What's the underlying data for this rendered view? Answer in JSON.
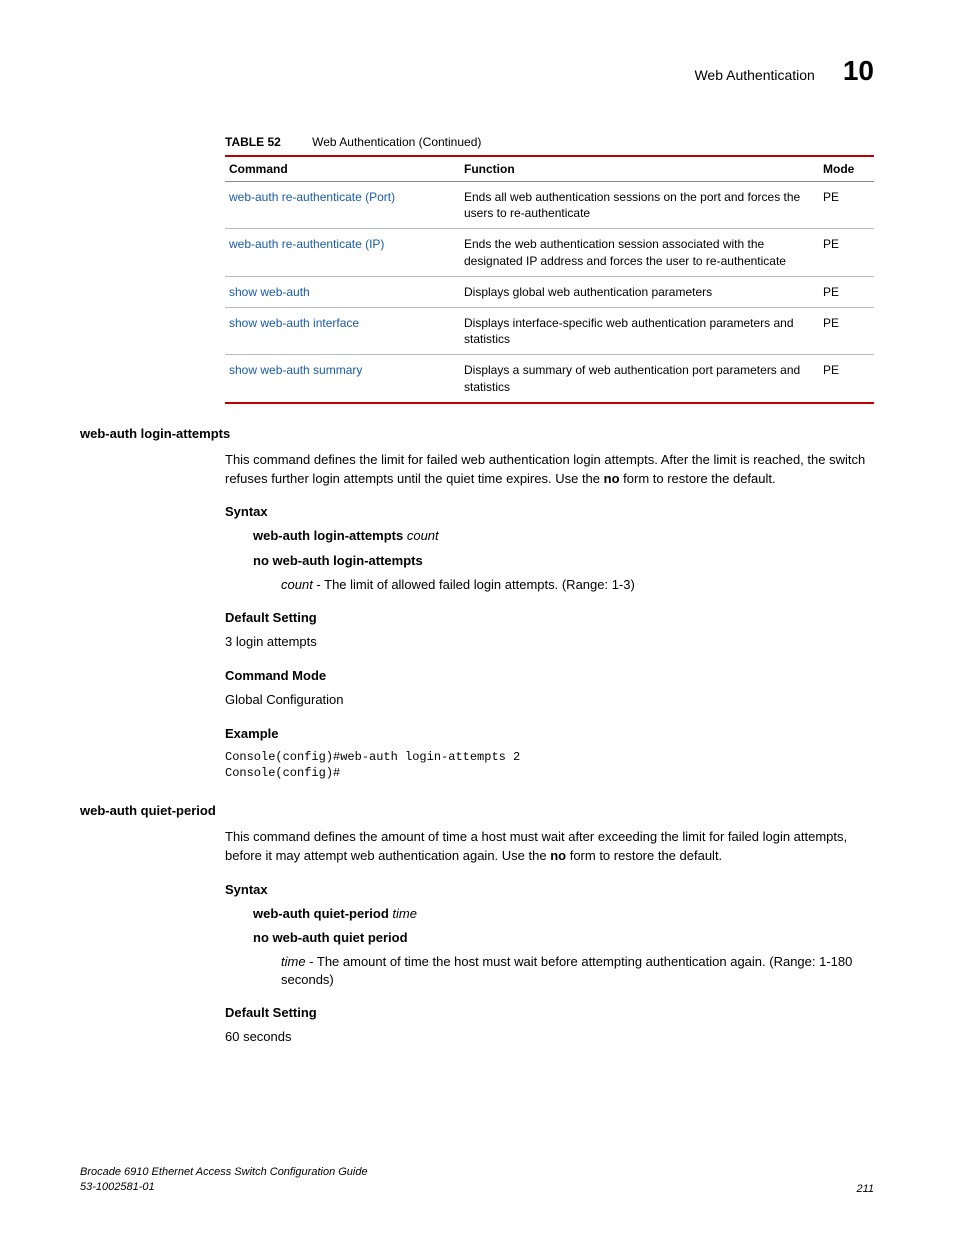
{
  "header": {
    "title": "Web Authentication",
    "chapter": "10"
  },
  "table": {
    "number": "TABLE 52",
    "caption": "Web Authentication (Continued)",
    "headers": {
      "command": "Command",
      "function": "Function",
      "mode": "Mode"
    },
    "rows": [
      {
        "command": "web-auth re-authenticate (Port)",
        "function": "Ends all web authentication sessions on the port and forces the users to re-authenticate",
        "mode": "PE"
      },
      {
        "command": "web-auth re-authenticate (IP)",
        "function": "Ends the web authentication session associated with the designated IP address and forces the user to re-authenticate",
        "mode": "PE"
      },
      {
        "command": "show web-auth",
        "function": "Displays global web authentication parameters",
        "mode": "PE"
      },
      {
        "command": "show web-auth interface",
        "function": "Displays interface-specific web authentication parameters and statistics",
        "mode": "PE"
      },
      {
        "command": "show web-auth summary",
        "function": "Displays a summary of web authentication port parameters and statistics",
        "mode": "PE"
      }
    ]
  },
  "sections": [
    {
      "name": "web-auth login-attempts",
      "intro_pre": "This command defines the limit for failed web authentication login attempts. After the limit is reached, the switch refuses further login attempts until the quiet time expires. Use the ",
      "intro_bold": "no",
      "intro_post": " form to restore the default.",
      "syntax_label": "Syntax",
      "syntax_cmd_bold": "web-auth login-attempts",
      "syntax_cmd_italic": "count",
      "syntax_no": "no web-auth login-attempts",
      "param_italic": "count",
      "param_desc": " - The limit of allowed failed login attempts. (Range: 1-3)",
      "default_label": "Default Setting",
      "default_value": "3 login attempts",
      "mode_label": "Command Mode",
      "mode_value": "Global Configuration",
      "example_label": "Example",
      "example_code": "Console(config)#web-auth login-attempts 2\nConsole(config)#"
    },
    {
      "name": "web-auth quiet-period",
      "intro_pre": "This command defines the amount of time a host must wait after exceeding the limit for failed login attempts, before it may attempt web authentication again. Use the ",
      "intro_bold": "no",
      "intro_post": " form to restore the default.",
      "syntax_label": "Syntax",
      "syntax_cmd_bold": "web-auth quiet-period",
      "syntax_cmd_italic": "time",
      "syntax_no": "no web-auth quiet period",
      "param_italic": "time",
      "param_desc": " - The amount of time the host must wait before attempting authentication again. (Range: 1-180 seconds)",
      "default_label": "Default Setting",
      "default_value": "60 seconds"
    }
  ],
  "footer": {
    "book": "Brocade 6910 Ethernet Access Switch Configuration Guide",
    "docnum": "53-1002581-01",
    "page": "211"
  }
}
